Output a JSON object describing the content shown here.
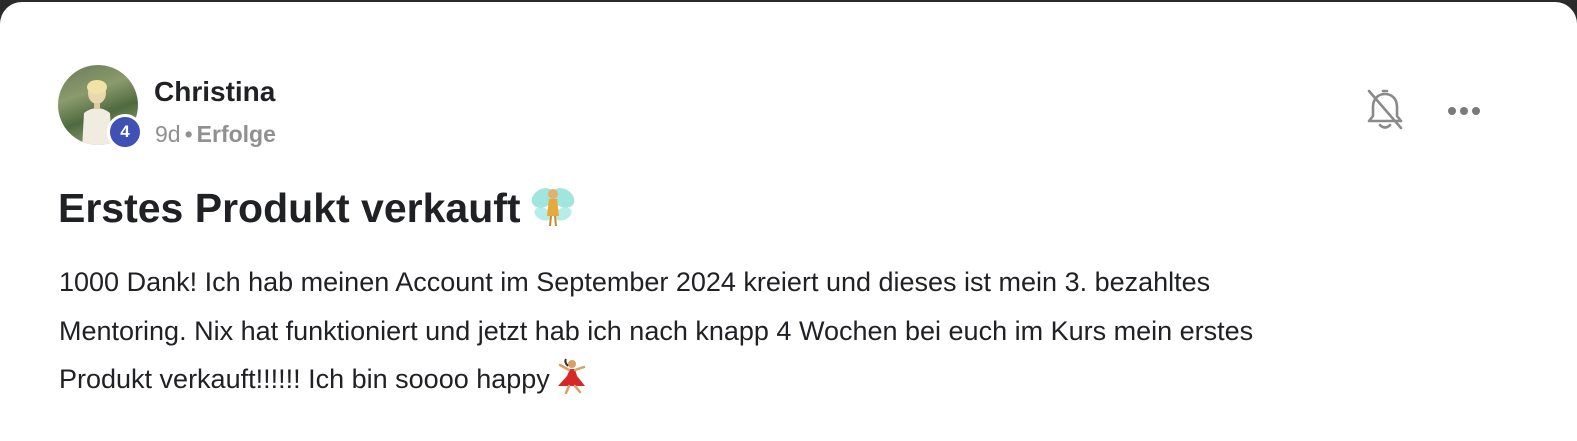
{
  "author": {
    "name": "Christina",
    "level": "4",
    "avatar_icon": "user-avatar-photo"
  },
  "meta": {
    "time": "9d",
    "separator": "•",
    "category": "Erfolge"
  },
  "actions": {
    "notification_icon": "bell-off-icon",
    "more_icon": "more-horizontal-icon"
  },
  "post": {
    "title": "Erstes Produkt verkauft",
    "title_emoji": "fairy-emoji",
    "body_lines": [
      "1000 Dank! Ich hab meinen Account im September 2024 kreiert und dieses ist mein 3. bezahltes",
      "Mentoring. Nix hat funktioniert und jetzt hab ich nach knapp 4 Wochen bei euch im Kurs mein erstes",
      "Produkt verkauft!!!!!! Ich bin soooo happy"
    ],
    "body_emoji": "dancer-emoji"
  },
  "colors": {
    "badge": "#3f51b5",
    "text": "#202124",
    "muted": "#909090",
    "background": "#ffffff"
  }
}
